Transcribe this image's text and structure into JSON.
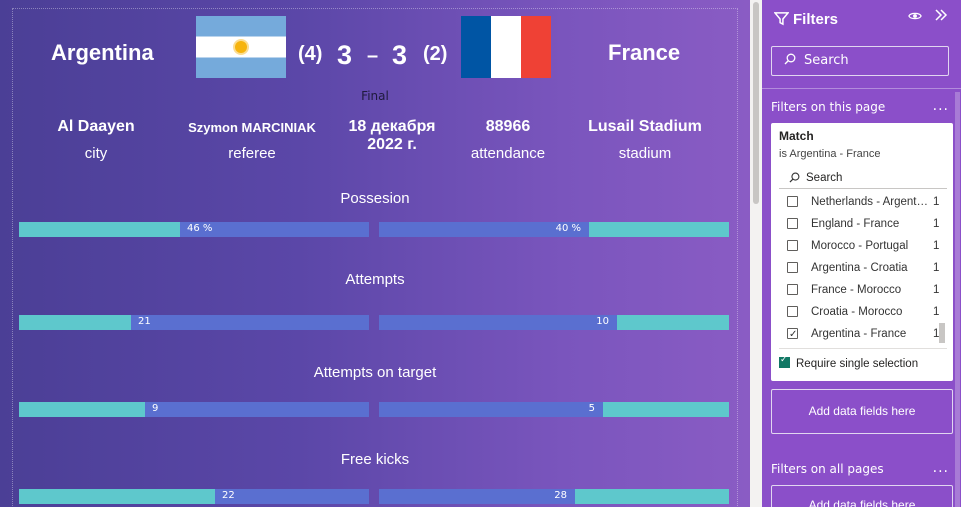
{
  "match": {
    "home": "Argentina",
    "away": "France",
    "home_pens": "(4)",
    "away_pens": "(2)",
    "home_score": "3",
    "dash": "–",
    "away_score": "3",
    "stage": "Final"
  },
  "info": [
    {
      "value": "Al Daayen",
      "label": "city"
    },
    {
      "value": "Szymon MARCINIAK",
      "label": "referee"
    },
    {
      "value": "18 декабря 2022 г.",
      "label": ""
    },
    {
      "value": "88966",
      "label": "attendance"
    },
    {
      "value": "Lusail Stadium",
      "label": "stadium"
    }
  ],
  "stats": [
    {
      "title": "Possesion",
      "home_label": "46 %",
      "away_label": "40 %",
      "home_fill": 0.46,
      "away_fill": 0.4
    },
    {
      "title": "Attempts",
      "home_label": "21",
      "away_label": "10",
      "home_fill": 0.32,
      "away_fill": 0.32
    },
    {
      "title": "Attempts on target",
      "home_label": "9",
      "away_label": "5",
      "home_fill": 0.36,
      "away_fill": 0.36
    },
    {
      "title": "Free kicks",
      "home_label": "22",
      "away_label": "28",
      "home_fill": 0.56,
      "away_fill": 0.44
    }
  ],
  "colors": {
    "bar_fill": "#5ec8cc",
    "bar_track": "#5a6fd0",
    "pane": "#8b4fc9"
  },
  "filters": {
    "title": "Filters",
    "search_placeholder": "Search",
    "on_this_page": "Filters on this page",
    "card": {
      "title": "Match",
      "subtitle": "is Argentina - France",
      "search": "Search",
      "options": [
        {
          "label": "Netherlands - Argentina",
          "count": "1",
          "checked": false
        },
        {
          "label": "England - France",
          "count": "1",
          "checked": false
        },
        {
          "label": "Morocco - Portugal",
          "count": "1",
          "checked": false
        },
        {
          "label": "Argentina - Croatia",
          "count": "1",
          "checked": false
        },
        {
          "label": "France - Morocco",
          "count": "1",
          "checked": false
        },
        {
          "label": "Croatia - Morocco",
          "count": "1",
          "checked": false
        },
        {
          "label": "Argentina - France",
          "count": "1",
          "checked": true
        }
      ],
      "require_single": "Require single selection"
    },
    "add_fields": "Add data fields here",
    "on_all_pages": "Filters on all pages",
    "add_fields_2": "Add data fields here",
    "more": "..."
  },
  "icons": {
    "filter": "filter-icon",
    "eye": "eye-icon",
    "collapse": "collapse-icon",
    "search": "search-icon"
  }
}
